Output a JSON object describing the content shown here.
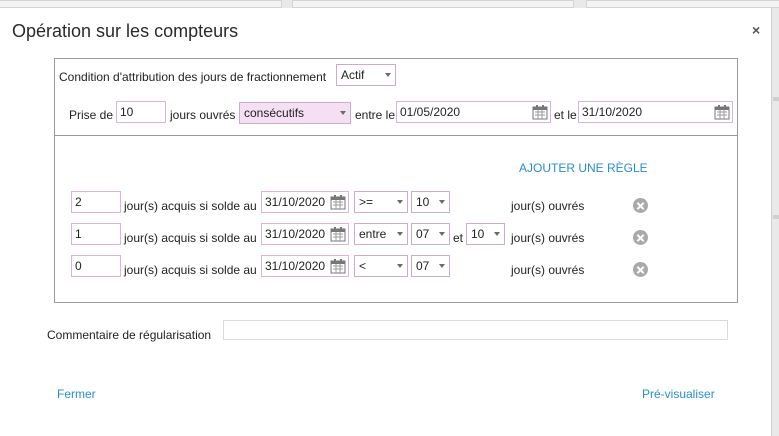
{
  "dialog": {
    "title": "Opération sur les compteurs",
    "close_symbol": "×"
  },
  "condition": {
    "label": "Condition d'attribution des jours de fractionnement",
    "value": "Actif"
  },
  "prise": {
    "label_before": "Prise de",
    "days_value": "10",
    "label_days": "jours ouvrés",
    "mode_value": "consécutifs",
    "label_between": "entre le",
    "start_date": "01/05/2020",
    "label_and": "et le",
    "end_date": "31/10/2020"
  },
  "rules": {
    "add_label": "AJOUTER UNE RÈGLE",
    "acquired_label": "jour(s) acquis si solde au",
    "unit_label": "jour(s) ouvrés",
    "and_label": "et",
    "items": [
      {
        "days": "2",
        "date": "31/10/2020",
        "operator": ">=",
        "value1": "10",
        "value2": ""
      },
      {
        "days": "1",
        "date": "31/10/2020",
        "operator": "entre",
        "value1": "07",
        "value2": "10"
      },
      {
        "days": "0",
        "date": "31/10/2020",
        "operator": "<",
        "value1": "07",
        "value2": ""
      }
    ]
  },
  "comment": {
    "label": "Commentaire de régularisation",
    "value": ""
  },
  "footer": {
    "close_label": "Fermer",
    "preview_label": "Pré-visualiser"
  },
  "icons": {
    "calendar": "calendar-icon",
    "remove": "remove-circle-icon",
    "close": "close-icon",
    "dropdown": "chevron-down-icon"
  },
  "colors": {
    "link": "#2a8ec9",
    "input_border": "#d7b6d7",
    "select_highlight": "#f4dff4"
  }
}
